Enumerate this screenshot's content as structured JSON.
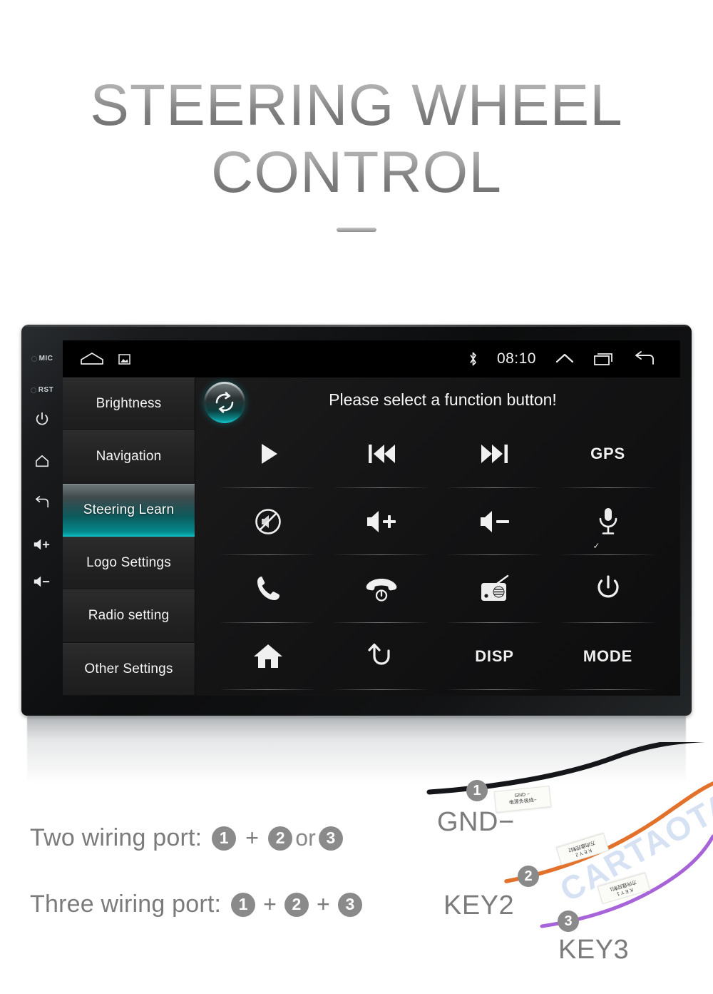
{
  "title": {
    "line1": "STEERING WHEEL",
    "line2": "CONTROL"
  },
  "device": {
    "bezel_buttons": [
      {
        "name": "mic-indicator",
        "label": "MIC"
      },
      {
        "name": "reset-indicator",
        "label": "RST"
      },
      {
        "name": "power-button",
        "label": ""
      },
      {
        "name": "home-button",
        "label": ""
      },
      {
        "name": "back-button",
        "label": ""
      },
      {
        "name": "volume-up-button",
        "label": ""
      },
      {
        "name": "volume-down-button",
        "label": ""
      }
    ],
    "statusbar": {
      "home_icon": "home-icon",
      "gallery_icon": "gallery-icon",
      "bluetooth_icon": "bluetooth-icon",
      "time": "08:10",
      "expand_icon": "chevron-up-icon",
      "recents_icon": "recent-apps-icon",
      "back_icon": "back-arrow-icon"
    },
    "sidebar": {
      "items": [
        {
          "label": "Brightness",
          "active": false
        },
        {
          "label": "Navigation",
          "active": false
        },
        {
          "label": "Steering Learn",
          "active": true
        },
        {
          "label": "Logo Settings",
          "active": false
        },
        {
          "label": "Radio setting",
          "active": false
        },
        {
          "label": "Other Settings",
          "active": false
        }
      ],
      "active_color": "#0bb6bb"
    },
    "panel": {
      "reset_icon": "refresh-icon",
      "prompt": "Please select a function button!",
      "buttons": [
        {
          "name": "play-button",
          "icon": "play-icon",
          "label": ""
        },
        {
          "name": "previous-button",
          "icon": "previous-icon",
          "label": ""
        },
        {
          "name": "next-button",
          "icon": "next-icon",
          "label": ""
        },
        {
          "name": "gps-button",
          "icon": "text",
          "label": "GPS"
        },
        {
          "name": "mute-button",
          "icon": "mute-icon",
          "label": ""
        },
        {
          "name": "volume-up-button",
          "icon": "volume-up-icon",
          "label": ""
        },
        {
          "name": "volume-down-button",
          "icon": "volume-down-icon",
          "label": ""
        },
        {
          "name": "voice-button",
          "icon": "microphone-icon",
          "label": "",
          "check": "✓"
        },
        {
          "name": "call-answer-button",
          "icon": "phone-icon",
          "label": ""
        },
        {
          "name": "call-hangup-button",
          "icon": "phone-hangup-icon",
          "label": ""
        },
        {
          "name": "radio-button",
          "icon": "radio-icon",
          "label": ""
        },
        {
          "name": "power-button",
          "icon": "power-icon",
          "label": ""
        },
        {
          "name": "home-button",
          "icon": "house-icon",
          "label": ""
        },
        {
          "name": "back-button",
          "icon": "back-undo-icon",
          "label": ""
        },
        {
          "name": "disp-button",
          "icon": "text",
          "label": "DISP"
        },
        {
          "name": "mode-button",
          "icon": "text",
          "label": "MODE"
        }
      ]
    }
  },
  "wiring": {
    "row1": {
      "label": "Two wiring port:",
      "a": "1",
      "op1": "+",
      "b": "2",
      "op2": "or",
      "c": "3"
    },
    "row2": {
      "label": "Three wiring port:",
      "a": "1",
      "op1": "+",
      "b": "2",
      "op2": "+",
      "c": "3"
    },
    "wires": [
      {
        "badge": "1",
        "label": "GND−",
        "color": "#15161a",
        "tag_line1": "GND −",
        "tag_line2": "电源负极线−"
      },
      {
        "badge": "2",
        "label": "KEY2",
        "color": "#e2712c",
        "tag_line1": "K E Y 2",
        "tag_line2": "方向盘控制2"
      },
      {
        "badge": "3",
        "label": "KEY3",
        "color": "#a764d8",
        "tag_line1": "K E Y 1",
        "tag_line2": "方向盘控制1"
      }
    ],
    "watermark": "CARTAOTAO"
  }
}
